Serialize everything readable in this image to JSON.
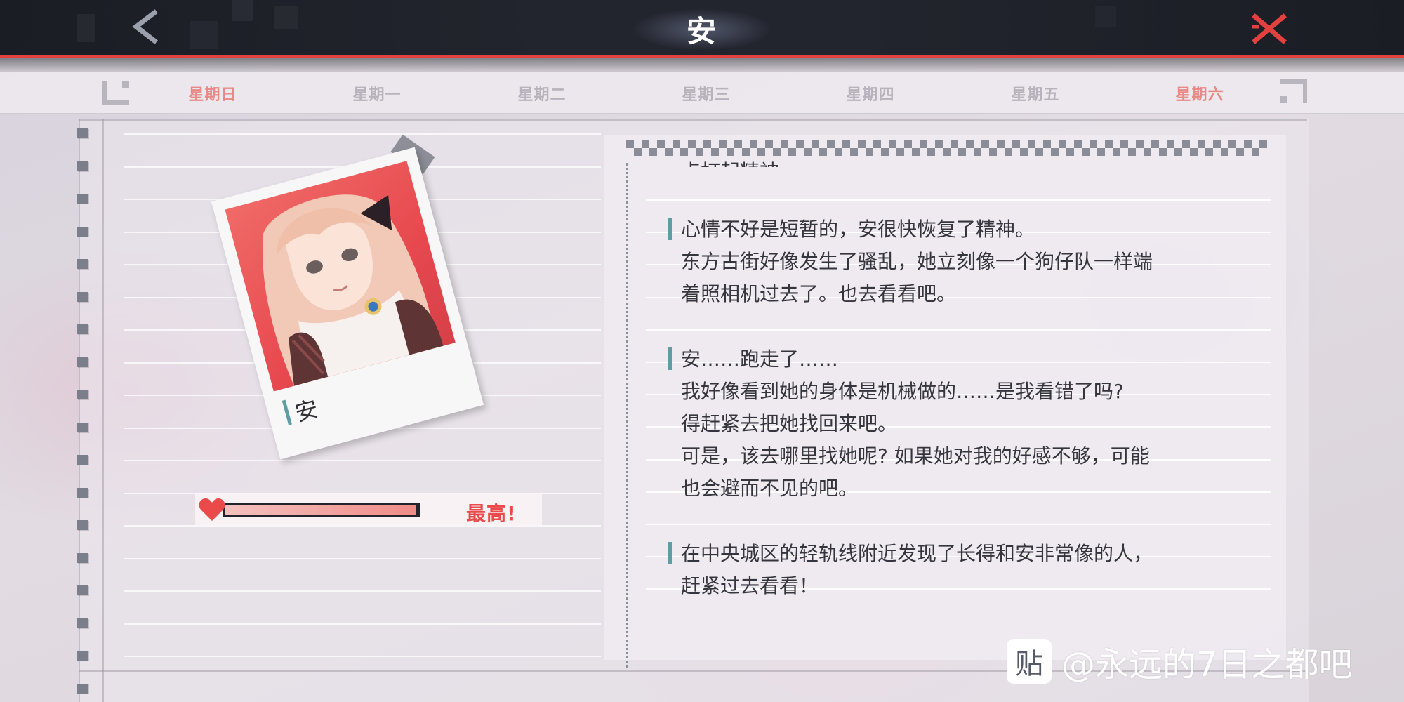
{
  "header": {
    "title": "安",
    "back_icon": "chevron-left-icon",
    "close_icon": "close-x-icon",
    "accent_color": "#e2413f"
  },
  "weekdays": [
    {
      "label": "星期日",
      "highlight": true
    },
    {
      "label": "星期一",
      "highlight": false
    },
    {
      "label": "星期二",
      "highlight": false
    },
    {
      "label": "星期三",
      "highlight": false
    },
    {
      "label": "星期四",
      "highlight": false
    },
    {
      "label": "星期五",
      "highlight": false
    },
    {
      "label": "星期六",
      "highlight": true
    }
  ],
  "character": {
    "name": "安",
    "photo_icon": "character-portrait",
    "photo_bg": "#ea4b52"
  },
  "affection": {
    "level": 1.0,
    "label": "最高!",
    "heart_icon": "heart-icon",
    "color": "#ea4a4a"
  },
  "diary": {
    "cut_top_text": "点打起精神。",
    "entries": [
      {
        "lines": [
          "心情不好是短暂的，安很快恢复了精神。",
          "东方古街好像发生了骚乱，她立刻像一个狗仔队一样端",
          "着照相机过去了。也去看看吧。"
        ]
      },
      {
        "lines": [
          "安……跑走了……",
          "我好像看到她的身体是机械做的……是我看错了吗?",
          "得赶紧去把她找回来吧。",
          "可是，该去哪里找她呢? 如果她对我的好感不够，可能",
          "也会避而不见的吧。"
        ]
      },
      {
        "lines": [
          "在中央城区的轻轨线附近发现了长得和安非常像的人，",
          "赶紧过去看看！"
        ]
      }
    ]
  },
  "watermark": {
    "logo_text": "贴",
    "text": "@永远的7日之都吧"
  }
}
